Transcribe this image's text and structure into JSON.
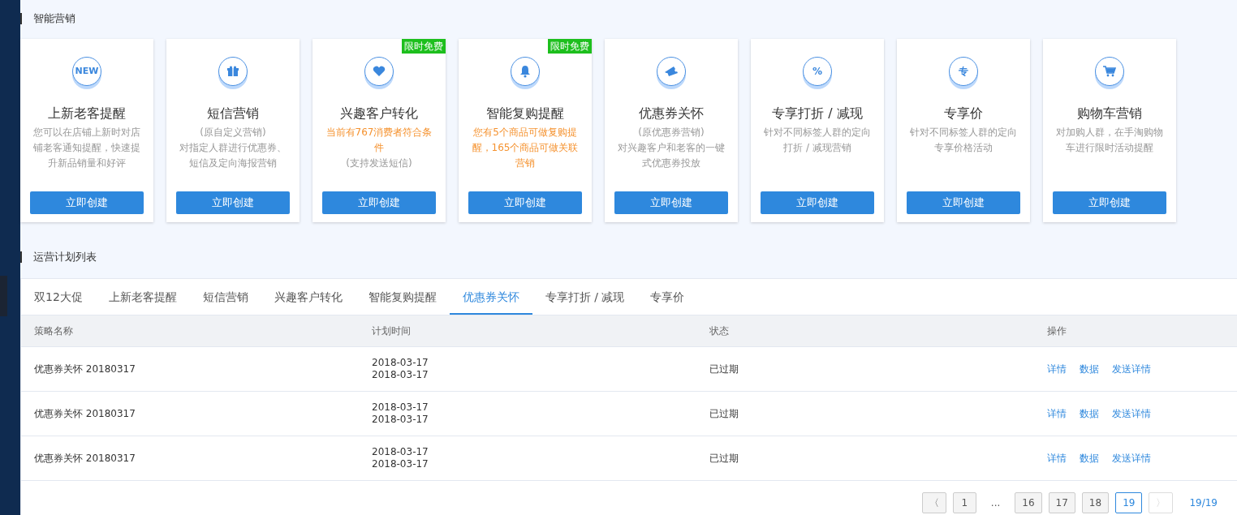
{
  "marketing": {
    "title": "智能营销",
    "cards": [
      {
        "kind": "new",
        "icon_text": "NEW",
        "title": "上新老客提醒",
        "lines": [
          "您可以在店铺上新时对店铺老客通知提醒，快速提升新品销量和好评"
        ],
        "highlight": false,
        "button": "立即创建"
      },
      {
        "kind": "gift",
        "title": "短信营销",
        "lines": [
          "(原自定义营销)",
          "对指定人群进行优惠券、短信及定向海报营销"
        ],
        "highlight": false,
        "button": "立即创建"
      },
      {
        "kind": "heart",
        "badge": "限时免费",
        "title": "兴趣客户转化",
        "lines": [
          "当前有767消费者符合条件",
          "(支持发送短信)"
        ],
        "highlight": true,
        "button": "立即创建"
      },
      {
        "kind": "bell",
        "badge": "限时免费",
        "title": "智能复购提醒",
        "lines": [
          "您有5个商品可做复购提醒，165个商品可做关联营销"
        ],
        "highlight": true,
        "button": "立即创建"
      },
      {
        "kind": "ticket",
        "title": "优惠券关怀",
        "lines": [
          "(原优惠券营销)",
          "对兴趣客户和老客的一键式优惠券投放"
        ],
        "highlight": false,
        "button": "立即创建"
      },
      {
        "kind": "percent",
        "icon_text": "%",
        "title": "专享打折 / 减现",
        "lines": [
          "针对不同标签人群的定向打折 / 减现营销"
        ],
        "highlight": false,
        "button": "立即创建"
      },
      {
        "kind": "glyph",
        "icon_text": "专",
        "title": "专享价",
        "lines": [
          "针对不同标签人群的定向专享价格活动"
        ],
        "highlight": false,
        "button": "立即创建"
      },
      {
        "kind": "cart",
        "title": "购物车营销",
        "lines": [
          "对加购人群，在手淘购物车进行限时活动提醒"
        ],
        "highlight": false,
        "button": "立即创建"
      }
    ]
  },
  "plans": {
    "title": "运营计划列表",
    "tabs": [
      {
        "label": "双12大促",
        "selected": false
      },
      {
        "label": "上新老客提醒",
        "selected": false
      },
      {
        "label": "短信营销",
        "selected": false
      },
      {
        "label": "兴趣客户转化",
        "selected": false
      },
      {
        "label": "智能复购提醒",
        "selected": false
      },
      {
        "label": "优惠券关怀",
        "selected": true
      },
      {
        "label": "专享打折 / 减现",
        "selected": false
      },
      {
        "label": "专享价",
        "selected": false
      }
    ],
    "table": {
      "columns": [
        "策略名称",
        "计划时间",
        "状态",
        "操作"
      ],
      "rows": [
        {
          "name": "优惠券关怀 20180317",
          "start": "2018-03-17",
          "end": "2018-03-17",
          "status": "已过期",
          "actions": [
            "详情",
            "数据",
            "发送详情"
          ]
        },
        {
          "name": "优惠券关怀 20180317",
          "start": "2018-03-17",
          "end": "2018-03-17",
          "status": "已过期",
          "actions": [
            "详情",
            "数据",
            "发送详情"
          ]
        },
        {
          "name": "优惠券关怀 20180317",
          "start": "2018-03-17",
          "end": "2018-03-17",
          "status": "已过期",
          "actions": [
            "详情",
            "数据",
            "发送详情"
          ]
        }
      ]
    },
    "pagination": {
      "pages": [
        {
          "label": "〈",
          "kind": "prev",
          "disabled": false
        },
        {
          "label": "1",
          "kind": "page",
          "selected": false
        },
        {
          "label": "...",
          "kind": "gap"
        },
        {
          "label": "16",
          "kind": "page",
          "selected": false
        },
        {
          "label": "17",
          "kind": "page",
          "selected": false
        },
        {
          "label": "18",
          "kind": "page",
          "selected": false
        },
        {
          "label": "19",
          "kind": "page",
          "selected": true
        },
        {
          "label": "〉",
          "kind": "next",
          "disabled": true
        }
      ],
      "summary": "19/19"
    }
  }
}
